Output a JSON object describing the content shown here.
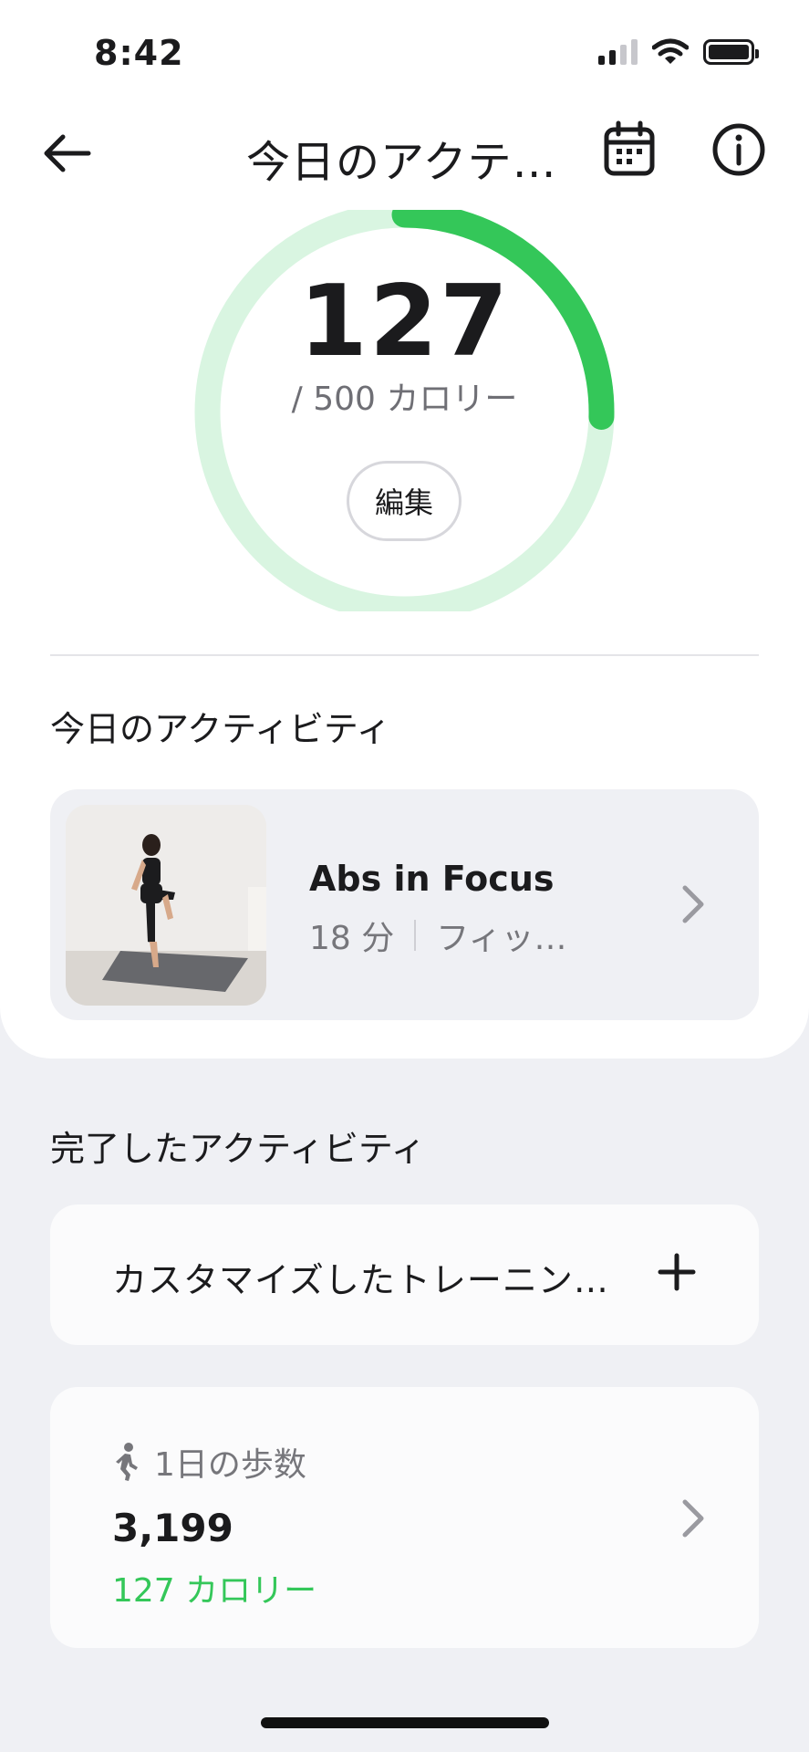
{
  "status_bar": {
    "time": "8:42"
  },
  "header": {
    "title": "今日のアクテ…"
  },
  "calorie_ring": {
    "value": "127",
    "goal_text": "/ 500  カロリー",
    "progress_fraction": 0.254,
    "edit_label": "編集",
    "track_color": "#d9f5e1",
    "progress_color": "#34c759"
  },
  "today_section": {
    "title": "今日のアクティビティ",
    "activity": {
      "name": "Abs in Focus",
      "duration": "18 分",
      "category": "フィッ…"
    }
  },
  "completed_section": {
    "title": "完了したアクティビティ",
    "custom_training_label": "カスタマイズしたトレーニン…",
    "steps": {
      "label": "1日の歩数",
      "value": "3,199",
      "calories": "127 カロリー"
    }
  },
  "icons": [
    "back-arrow-icon",
    "calendar-icon",
    "info-icon",
    "chevron-right-icon",
    "plus-icon",
    "walking-icon"
  ]
}
